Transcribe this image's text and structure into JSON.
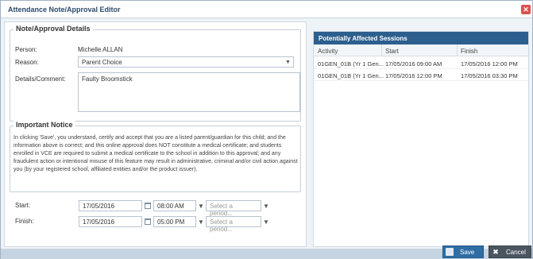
{
  "dialog": {
    "title": "Attendance Note/Approval Editor",
    "close_icon": "close-icon"
  },
  "details": {
    "legend": "Note/Approval Details",
    "person_label": "Person:",
    "person_value": "Michelle ALLAN",
    "reason_label": "Reason:",
    "reason_value": "Parent Choice",
    "comment_label": "Details/Comment:",
    "comment_value": "Faulty Broomstick"
  },
  "notice": {
    "legend": "Important Notice",
    "text": "In clicking 'Save', you understand, certify and accept that you are a listed parent/guardian for this child; and the information above is correct; and this online approval does NOT constitute a medical certificate; and students enrolled in VCE are required to submit a medical certificate to the school in addition to this approval; and any fraudulent action or intentional misuse of this feature may result in administrative, criminal and/or civil action against you (by your registered school, affiliated entities and/or the product issuer)."
  },
  "schedule": {
    "start_label": "Start:",
    "start_date": "17/05/2016",
    "start_time": "08:00 AM",
    "finish_label": "Finish:",
    "finish_date": "17/05/2016",
    "finish_time": "05:00 PM",
    "period_placeholder": "Select a period..."
  },
  "sessions": {
    "title": "Potentially Affected Sessions",
    "columns": [
      "Activity",
      "Start",
      "Finish"
    ],
    "rows": [
      [
        "01GEN_01B (Yr 1 Gen...",
        "17/05/2016 09:00 AM",
        "17/05/2016 12:00 PM"
      ],
      [
        "01GEN_01B (Yr 1 Gen...",
        "17/05/2016 12:00 PM",
        "17/05/2016 03:30 PM"
      ]
    ]
  },
  "buttons": {
    "save": "Save",
    "cancel": "Cancel"
  }
}
